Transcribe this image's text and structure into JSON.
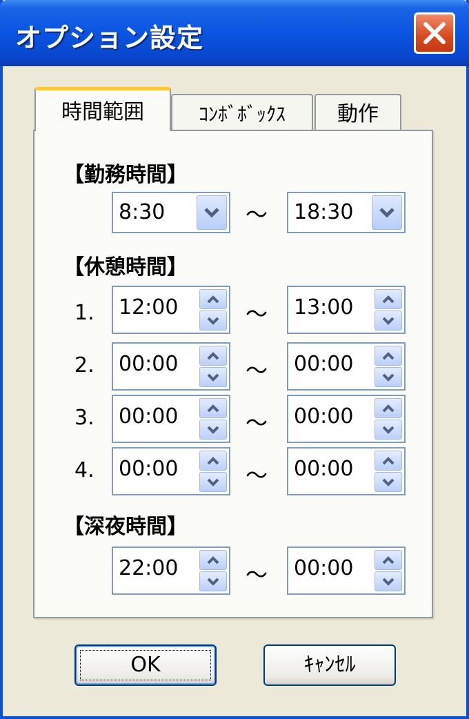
{
  "window": {
    "title": "オプション設定"
  },
  "tabs": [
    {
      "label": "時間範囲",
      "active": true
    },
    {
      "label": "ｺﾝﾎﾞﾎﾞｯｸｽ",
      "active": false
    },
    {
      "label": "動作",
      "active": false
    }
  ],
  "work_time": {
    "heading": "【勤務時間】",
    "start": "8:30",
    "end": "18:30",
    "separator": "～"
  },
  "break_time": {
    "heading": "【休憩時間】",
    "rows": [
      {
        "num": "1.",
        "start": "12:00",
        "end": "13:00"
      },
      {
        "num": "2.",
        "start": "00:00",
        "end": "00:00"
      },
      {
        "num": "3.",
        "start": "00:00",
        "end": "00:00"
      },
      {
        "num": "4.",
        "start": "00:00",
        "end": "00:00"
      }
    ],
    "separator": "～"
  },
  "night_time": {
    "heading": "【深夜時間】",
    "start": "22:00",
    "end": "00:00",
    "separator": "～"
  },
  "buttons": {
    "ok": "OK",
    "cancel": "ｷｬﾝｾﾙ"
  },
  "colors": {
    "titlebar": "#0a54e3",
    "close": "#d8481f",
    "tab_active_accent": "#ffc73c"
  },
  "icons": {
    "close": "close-icon",
    "dropdown": "chevron-down-icon",
    "spin_up": "chevron-up-icon",
    "spin_down": "chevron-down-icon"
  }
}
